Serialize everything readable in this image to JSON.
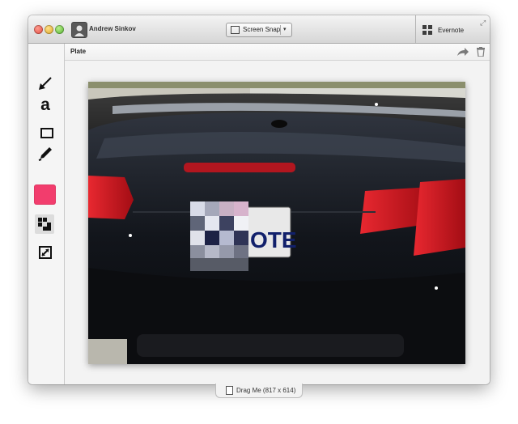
{
  "window": {
    "user_name": "Andrew Sinkov",
    "snap_button_label": "Screen Snap",
    "evernote_label": "Evernote"
  },
  "toolbar": {
    "tools": [
      "arrow-tool",
      "text-tool",
      "rectangle-tool",
      "pen-tool",
      "color-picker",
      "pixelate-tool",
      "crop-tool"
    ],
    "text_tool_glyph": "a",
    "selected_color": "#f23d6d"
  },
  "note": {
    "title": "Plate"
  },
  "image": {
    "subject": "black convertible car rear with pixelated license plate",
    "plate_visible_text": "OTE"
  },
  "drag_handle": {
    "label": "Drag Me (817 x 614)"
  },
  "colors": {
    "accent": "#f23d6d",
    "titlebar": "#d6d6d6",
    "canvas": "#f3f3f3"
  }
}
